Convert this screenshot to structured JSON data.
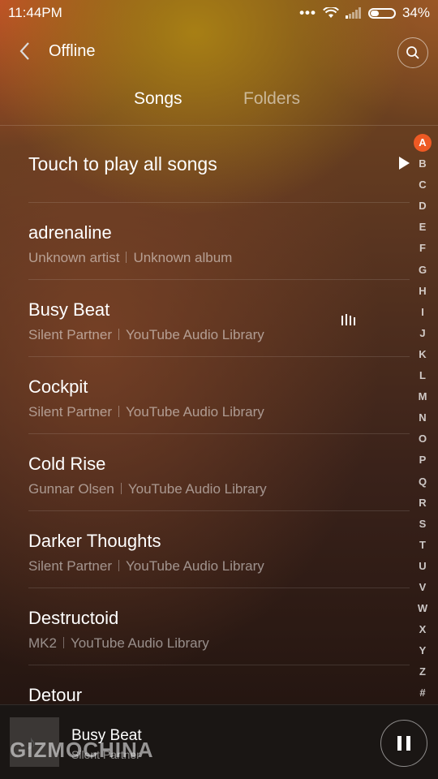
{
  "status_bar": {
    "time": "11:44PM",
    "battery": "34%",
    "signal": "wifi and cellular signal",
    "more": "•••"
  },
  "header": {
    "back_icon": "chevron-left-icon",
    "title": "Offline",
    "search_icon": "search-icon"
  },
  "tabs": [
    {
      "label": "Songs",
      "active": true
    },
    {
      "label": "Folders",
      "active": false
    }
  ],
  "play_all": {
    "label": "Touch to play all songs",
    "icon": "play-icon"
  },
  "songs": [
    {
      "title": "adrenaline",
      "artist": "Unknown artist",
      "album": "Unknown album",
      "playing": false
    },
    {
      "title": "Busy Beat",
      "artist": "Silent Partner",
      "album": "YouTube Audio Library",
      "playing": true
    },
    {
      "title": "Cockpit",
      "artist": "Silent Partner",
      "album": "YouTube Audio Library",
      "playing": false
    },
    {
      "title": "Cold Rise",
      "artist": "Gunnar Olsen",
      "album": "YouTube Audio Library",
      "playing": false
    },
    {
      "title": "Darker Thoughts",
      "artist": "Silent Partner",
      "album": "YouTube Audio Library",
      "playing": false
    },
    {
      "title": "Destructoid",
      "artist": "MK2",
      "album": "YouTube Audio Library",
      "playing": false
    },
    {
      "title": "Detour",
      "artist": "",
      "album": "",
      "playing": false
    }
  ],
  "alphabet": [
    "A",
    "B",
    "C",
    "D",
    "E",
    "F",
    "G",
    "H",
    "I",
    "J",
    "K",
    "L",
    "M",
    "N",
    "O",
    "P",
    "Q",
    "R",
    "S",
    "T",
    "U",
    "V",
    "W",
    "X",
    "Y",
    "Z",
    "#"
  ],
  "alphabet_active": "A",
  "now_playing": {
    "title": "Busy Beat",
    "artist": "Silent Partner",
    "control_icon": "pause-icon"
  },
  "watermark": "GIZMOCHINA",
  "colors": {
    "accent": "#ee5a24",
    "player_bg": "#1a1614"
  }
}
